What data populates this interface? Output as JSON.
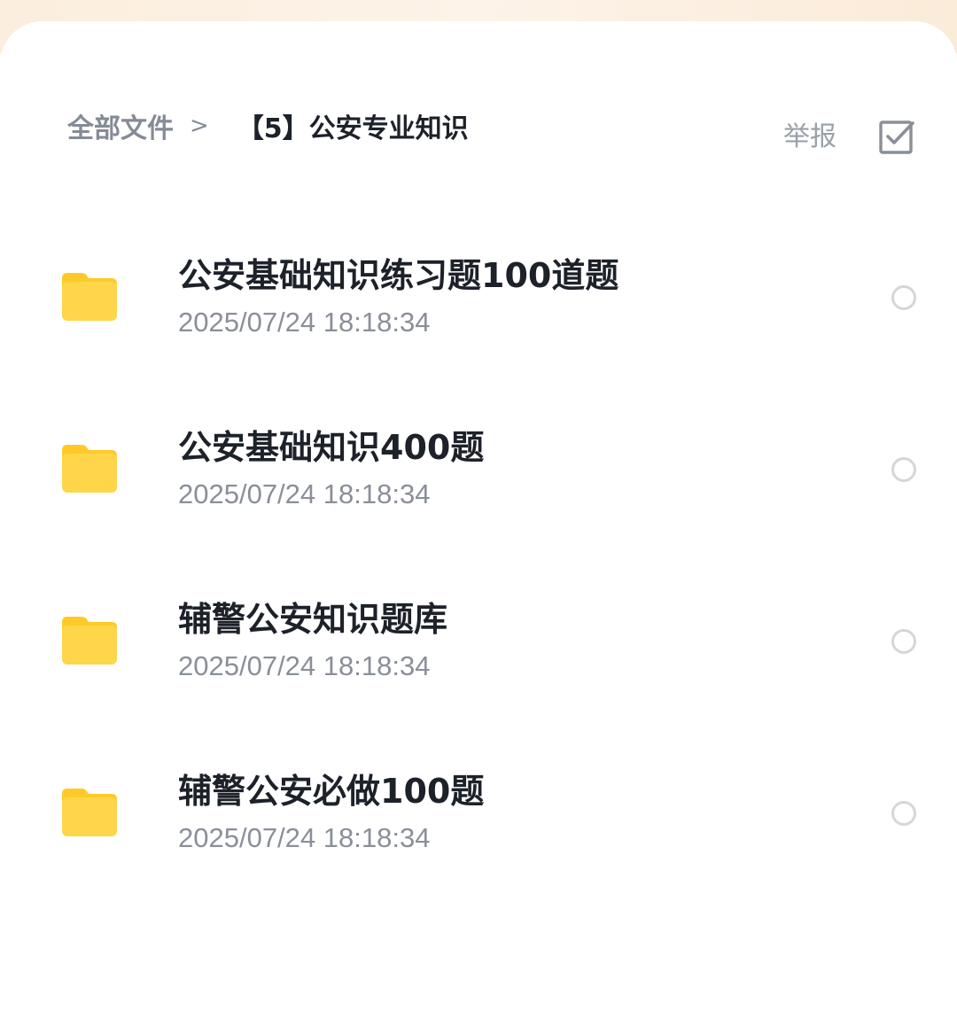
{
  "breadcrumb": {
    "root": "全部文件",
    "separator": ">",
    "current": "【5】公安专业知识"
  },
  "header": {
    "report_label": "举报",
    "select_icon": "checkbox-icon"
  },
  "colors": {
    "folder": "#ffd54a",
    "folder_tab": "#ffca28",
    "title_text": "#1d2129",
    "muted_text": "#8a8f98",
    "radio_border": "#d4d6da"
  },
  "files": [
    {
      "name": "公安基础知识练习题100道题",
      "date": "2025/07/24 18:18:34",
      "icon": "folder-icon"
    },
    {
      "name": "公安基础知识400题",
      "date": "2025/07/24 18:18:34",
      "icon": "folder-icon"
    },
    {
      "name": "辅警公安知识题库",
      "date": "2025/07/24 18:18:34",
      "icon": "folder-icon"
    },
    {
      "name": "辅警公安必做100题",
      "date": "2025/07/24 18:18:34",
      "icon": "folder-icon"
    }
  ]
}
